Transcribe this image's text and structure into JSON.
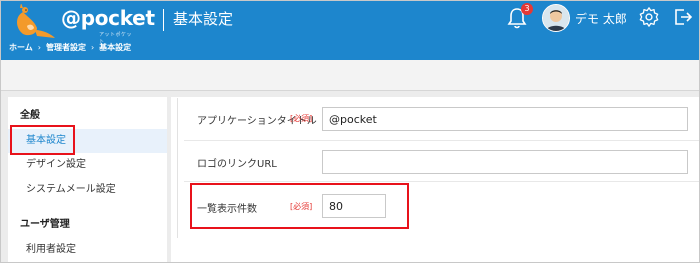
{
  "app": {
    "logo_text": "@pocket",
    "logo_sub": "アットポケット",
    "page_title": "基本設定",
    "notification_count": "3",
    "user_name": "デモ 太郎"
  },
  "breadcrumb": [
    "ホーム",
    "管理者設定",
    "基本設定"
  ],
  "sidebar": {
    "sections": [
      {
        "heading": "全般",
        "items": [
          {
            "label": "基本設定",
            "active": true
          },
          {
            "label": "デザイン設定",
            "active": false
          },
          {
            "label": "システムメール設定",
            "active": false
          }
        ]
      },
      {
        "heading": "ユーザ管理",
        "items": [
          {
            "label": "利用者設定",
            "active": false
          }
        ]
      }
    ]
  },
  "form": {
    "fields": [
      {
        "label": "アプリケーションタイトル",
        "required": "[必須]",
        "value": "@pocket"
      },
      {
        "label": "ロゴのリンクURL",
        "required": "",
        "value": ""
      },
      {
        "label": "一覧表示件数",
        "required": "[必須]",
        "value": "80"
      }
    ]
  },
  "colors": {
    "header": "#1d86cd",
    "highlight": "#e8121b",
    "required": "#e53935",
    "badge": "#e53935"
  },
  "icons": [
    "kangaroo-logo-icon",
    "bell-icon",
    "avatar",
    "gear-icon",
    "logout-icon"
  ]
}
